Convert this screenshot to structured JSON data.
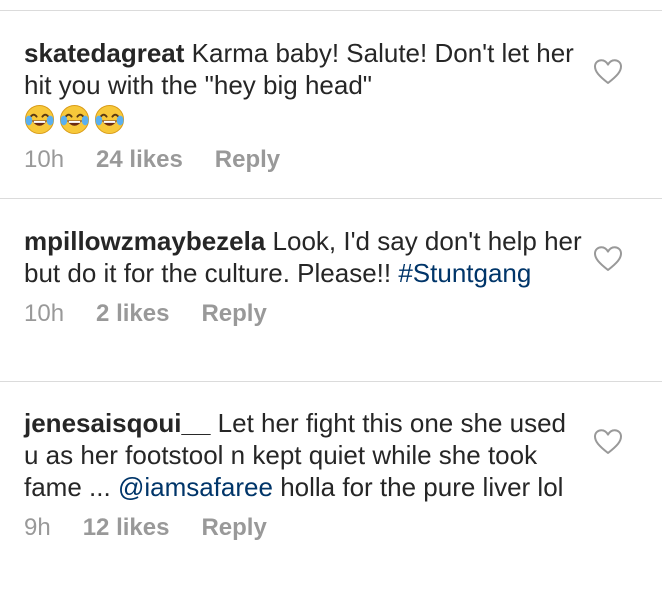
{
  "comments": [
    {
      "username": "skatedagreat",
      "text": "Karma baby! Salute! Don't let her hit you with the \"hey big head\"",
      "emoji_count": 3,
      "emoji_name": "face-with-tears-of-joy",
      "time": "10h",
      "likes": "24 likes",
      "reply": "Reply",
      "like_icon": "heart-outline-icon"
    },
    {
      "username": "mpillowzmaybezela",
      "text_before": "Look, I'd say don't help her but do it for the culture. Please!!",
      "hashtag": "#Stuntgang",
      "time": "10h",
      "likes": "2 likes",
      "reply": "Reply",
      "like_icon": "heart-outline-icon"
    },
    {
      "username": "jenesaisqoui__",
      "text_before": "Let her fight this one she used u as her footstool n kept quiet while she took fame ...",
      "mention": "@iamsafaree",
      "text_after": "holla for the pure liver lol",
      "time": "9h",
      "likes": "12 likes",
      "reply": "Reply",
      "like_icon": "heart-outline-icon"
    }
  ],
  "colors": {
    "text": "#262626",
    "meta": "#999999",
    "link": "#003569",
    "divider": "#dbdbdb",
    "emoji_face": "#f7c83a"
  }
}
